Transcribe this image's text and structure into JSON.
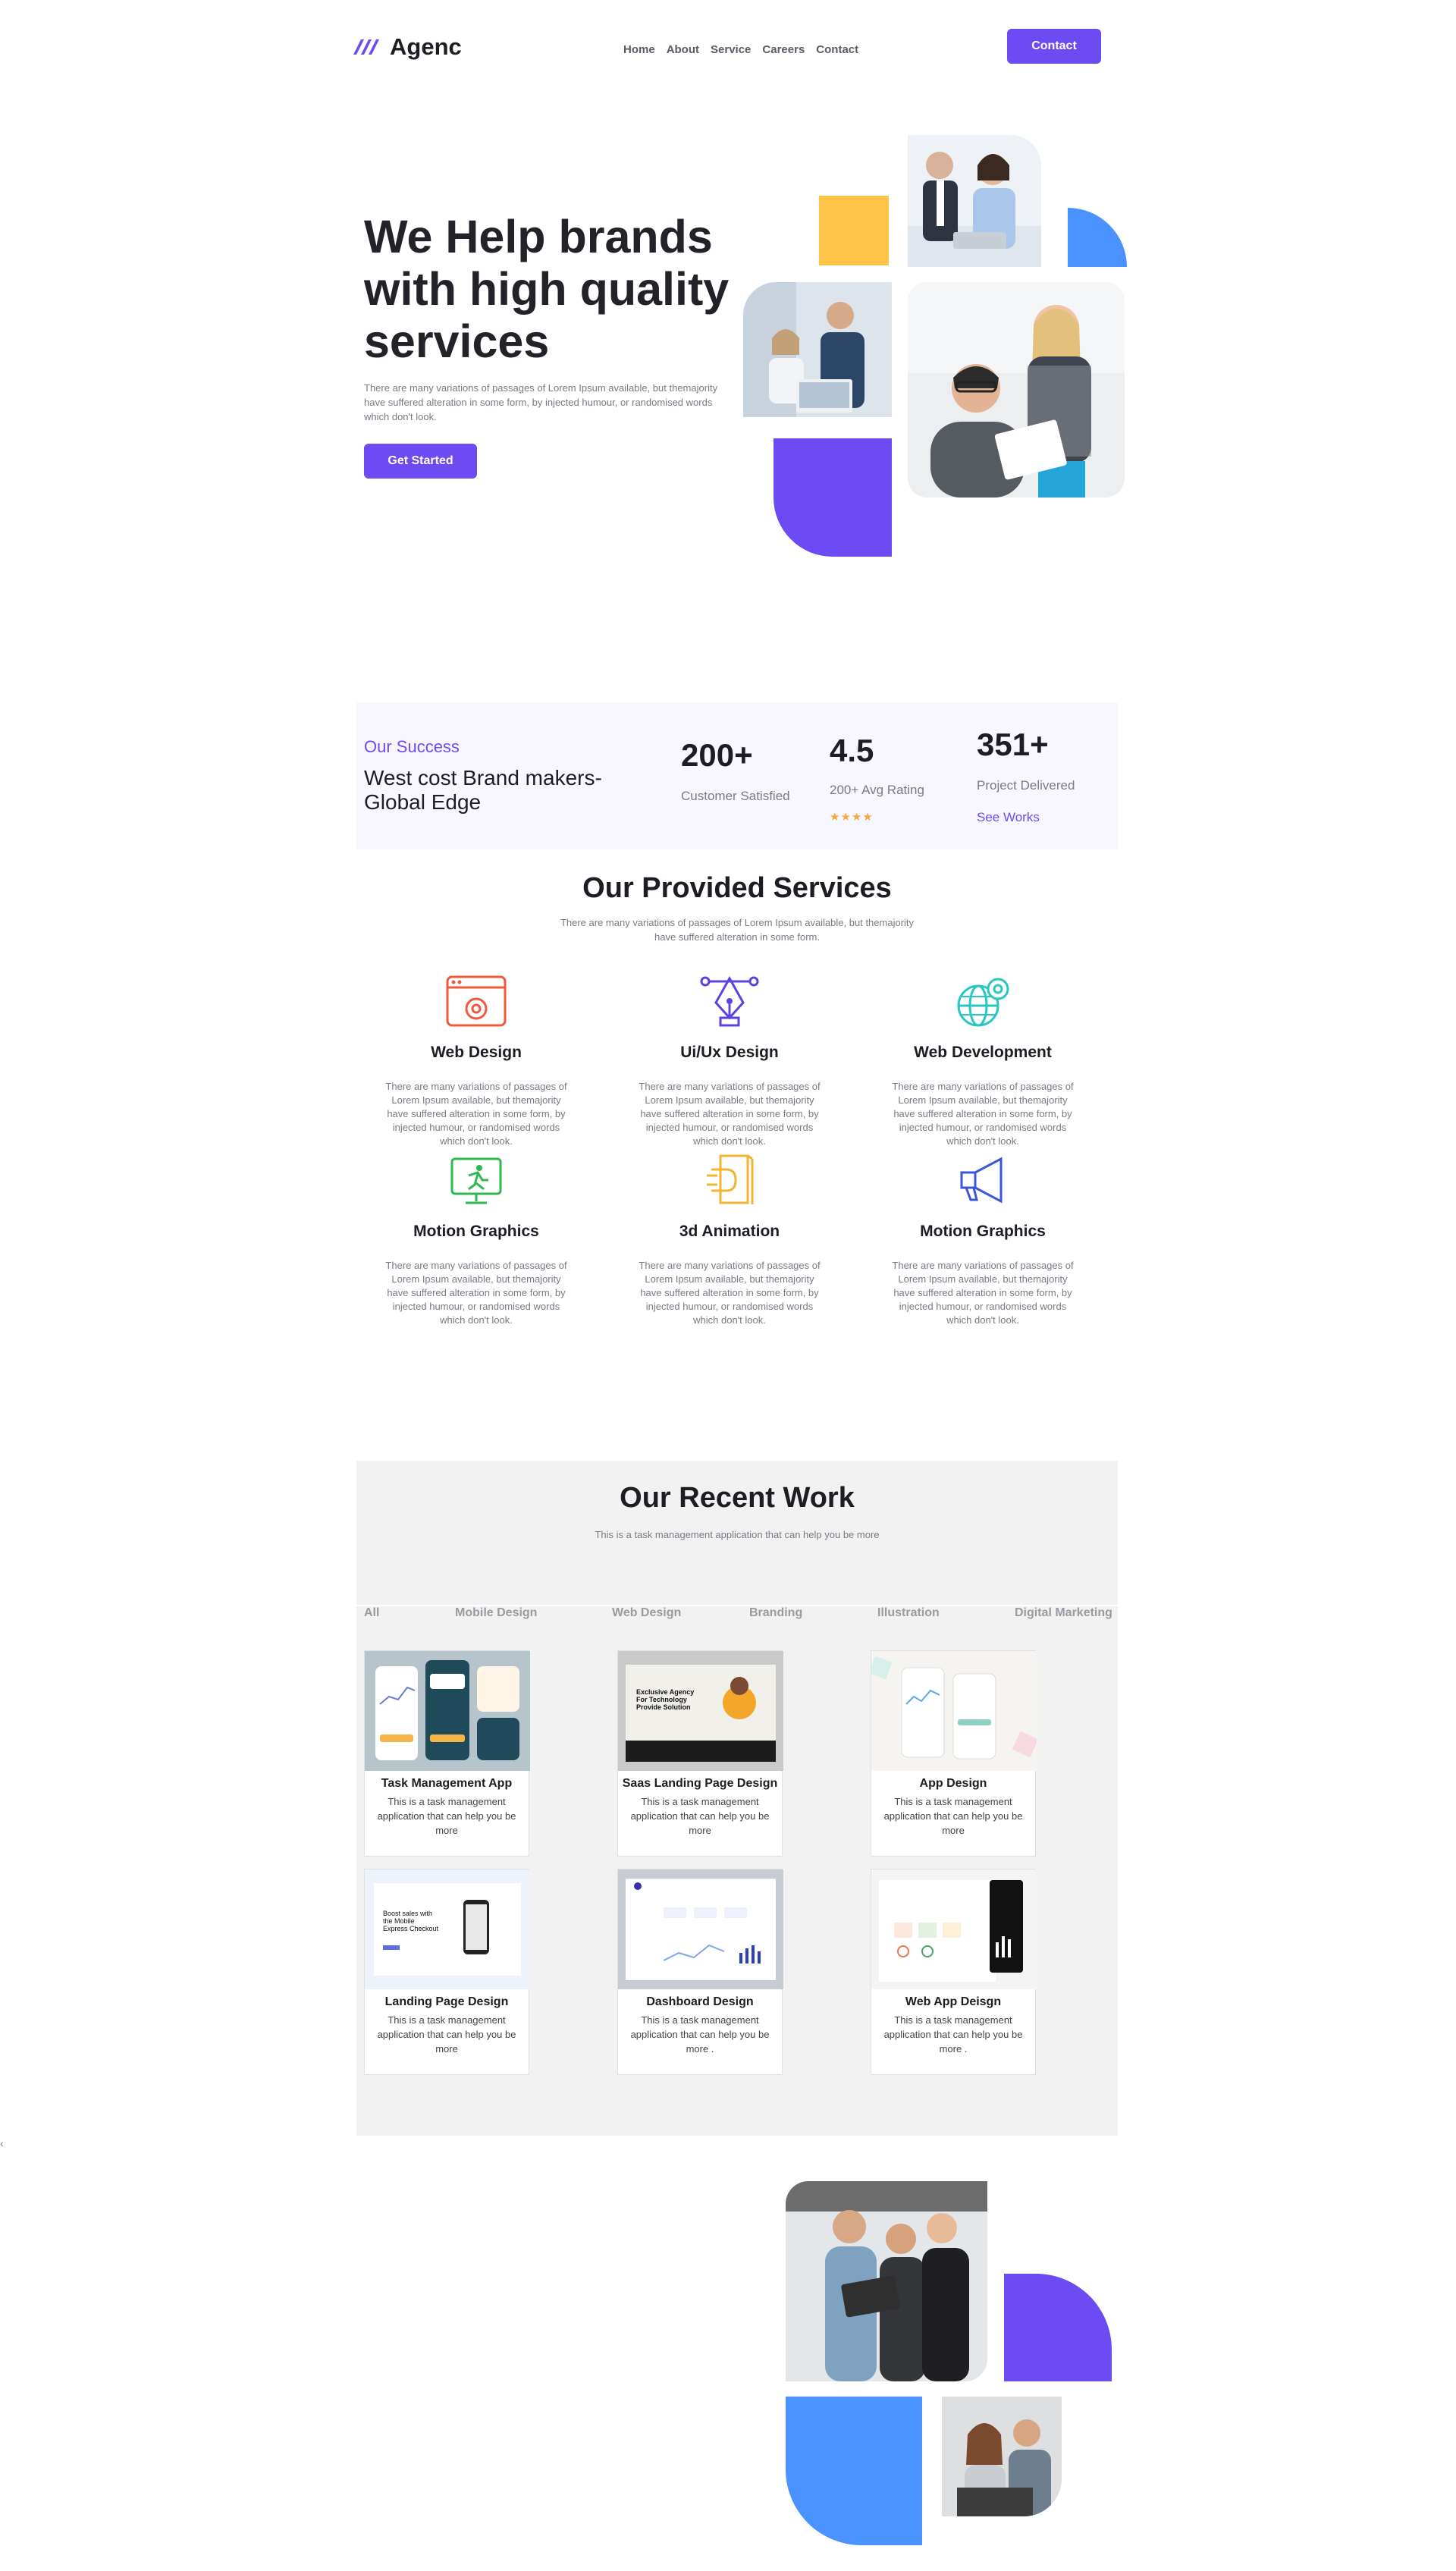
{
  "header": {
    "logo_text": "Agenc",
    "nav": [
      "Home",
      "About",
      "Service",
      "Careers",
      "Contact"
    ],
    "contact_label": "Contact"
  },
  "hero": {
    "title": "We Help brands with high quality services",
    "description": "There are many variations of passages of Lorem Ipsum available, but themajority have suffered alteration in some form, by injected humour, or randomised words which don't look.",
    "cta": "Get Started"
  },
  "success": {
    "label": "Our Success",
    "title": "West cost Brand makers-Global Edge",
    "stats": [
      {
        "value": "200+",
        "label": "Customer Satisfied"
      },
      {
        "value": "4.5",
        "label": "200+ Avg Rating",
        "stars": 4
      },
      {
        "value": "351+",
        "label": "Project Delivered",
        "link": "See Works"
      }
    ]
  },
  "services": {
    "title": "Our Provided Services",
    "subtitle": "There are many variations of passages of Lorem Ipsum available, but themajority have suffered alteration in some form.",
    "items": [
      {
        "title": "Web Design",
        "icon": "web-design-icon",
        "color": "#ef5a3c",
        "desc": "There are many variations of passages of Lorem Ipsum available, but themajority have suffered alteration in some form, by injected humour, or randomised words which don't look."
      },
      {
        "title": "Ui/Ux Design",
        "icon": "pen-tool-icon",
        "color": "#5b43e0",
        "desc": "There are many variations of passages of Lorem Ipsum available, but themajority have suffered alteration in some form, by injected humour, or randomised words which don't look."
      },
      {
        "title": "Web Development",
        "icon": "globe-gear-icon",
        "color": "#2ac7c1",
        "desc": "There are many variations of passages of Lorem Ipsum available, but themajority have suffered alteration in some form, by injected humour, or randomised words which don't look."
      },
      {
        "title": "Motion Graphics",
        "icon": "monitor-runner-icon",
        "color": "#2fb84f",
        "desc": "There are many variations of passages of Lorem Ipsum available, but themajority have suffered alteration in some form, by injected humour, or randomised words which don't look."
      },
      {
        "title": "3d Animation",
        "icon": "3d-box-icon",
        "color": "#f4b433",
        "desc": "There are many variations of passages of Lorem Ipsum available, but themajority have suffered alteration in some form, by injected humour, or randomised words which don't look."
      },
      {
        "title": "Motion Graphics",
        "icon": "megaphone-icon",
        "color": "#3c56d8",
        "desc": "There are many variations of passages of Lorem Ipsum available, but themajority have suffered alteration in some form, by injected humour, or randomised words which don't look."
      }
    ]
  },
  "work": {
    "title": "Our Recent Work",
    "subtitle": "This is a task management application that can help you be more",
    "tabs": [
      "All",
      "Mobile Design",
      "Web Design",
      "Branding",
      "Illustration",
      "Digital Marketing"
    ],
    "cards": [
      {
        "title": "Task Management App",
        "desc": "This is a task management application that can help you be more"
      },
      {
        "title": "Saas Landing Page Design",
        "desc": "This is a task management application that can help you be more"
      },
      {
        "title": "App Design",
        "desc": "This is a task management application that can help you be more"
      },
      {
        "title": "Landing Page Design",
        "desc": "This is a task management application that can help you be more"
      },
      {
        "title": "Dashboard Design",
        "desc": "This is a task management application that can help you be more ."
      },
      {
        "title": "Web App Deisgn",
        "desc": "This is a task management application that can help you be more ."
      }
    ],
    "thumb_texts": {
      "saas": "Exclusive Agency For Technology Provide Solution",
      "landing": "Boost sales with the Mobile Express Checkout"
    }
  },
  "colors": {
    "primary": "#6c4bf3",
    "yellow": "#fec44a",
    "blue": "#4a92ff"
  },
  "misc": {
    "left_arrow": "‹"
  }
}
